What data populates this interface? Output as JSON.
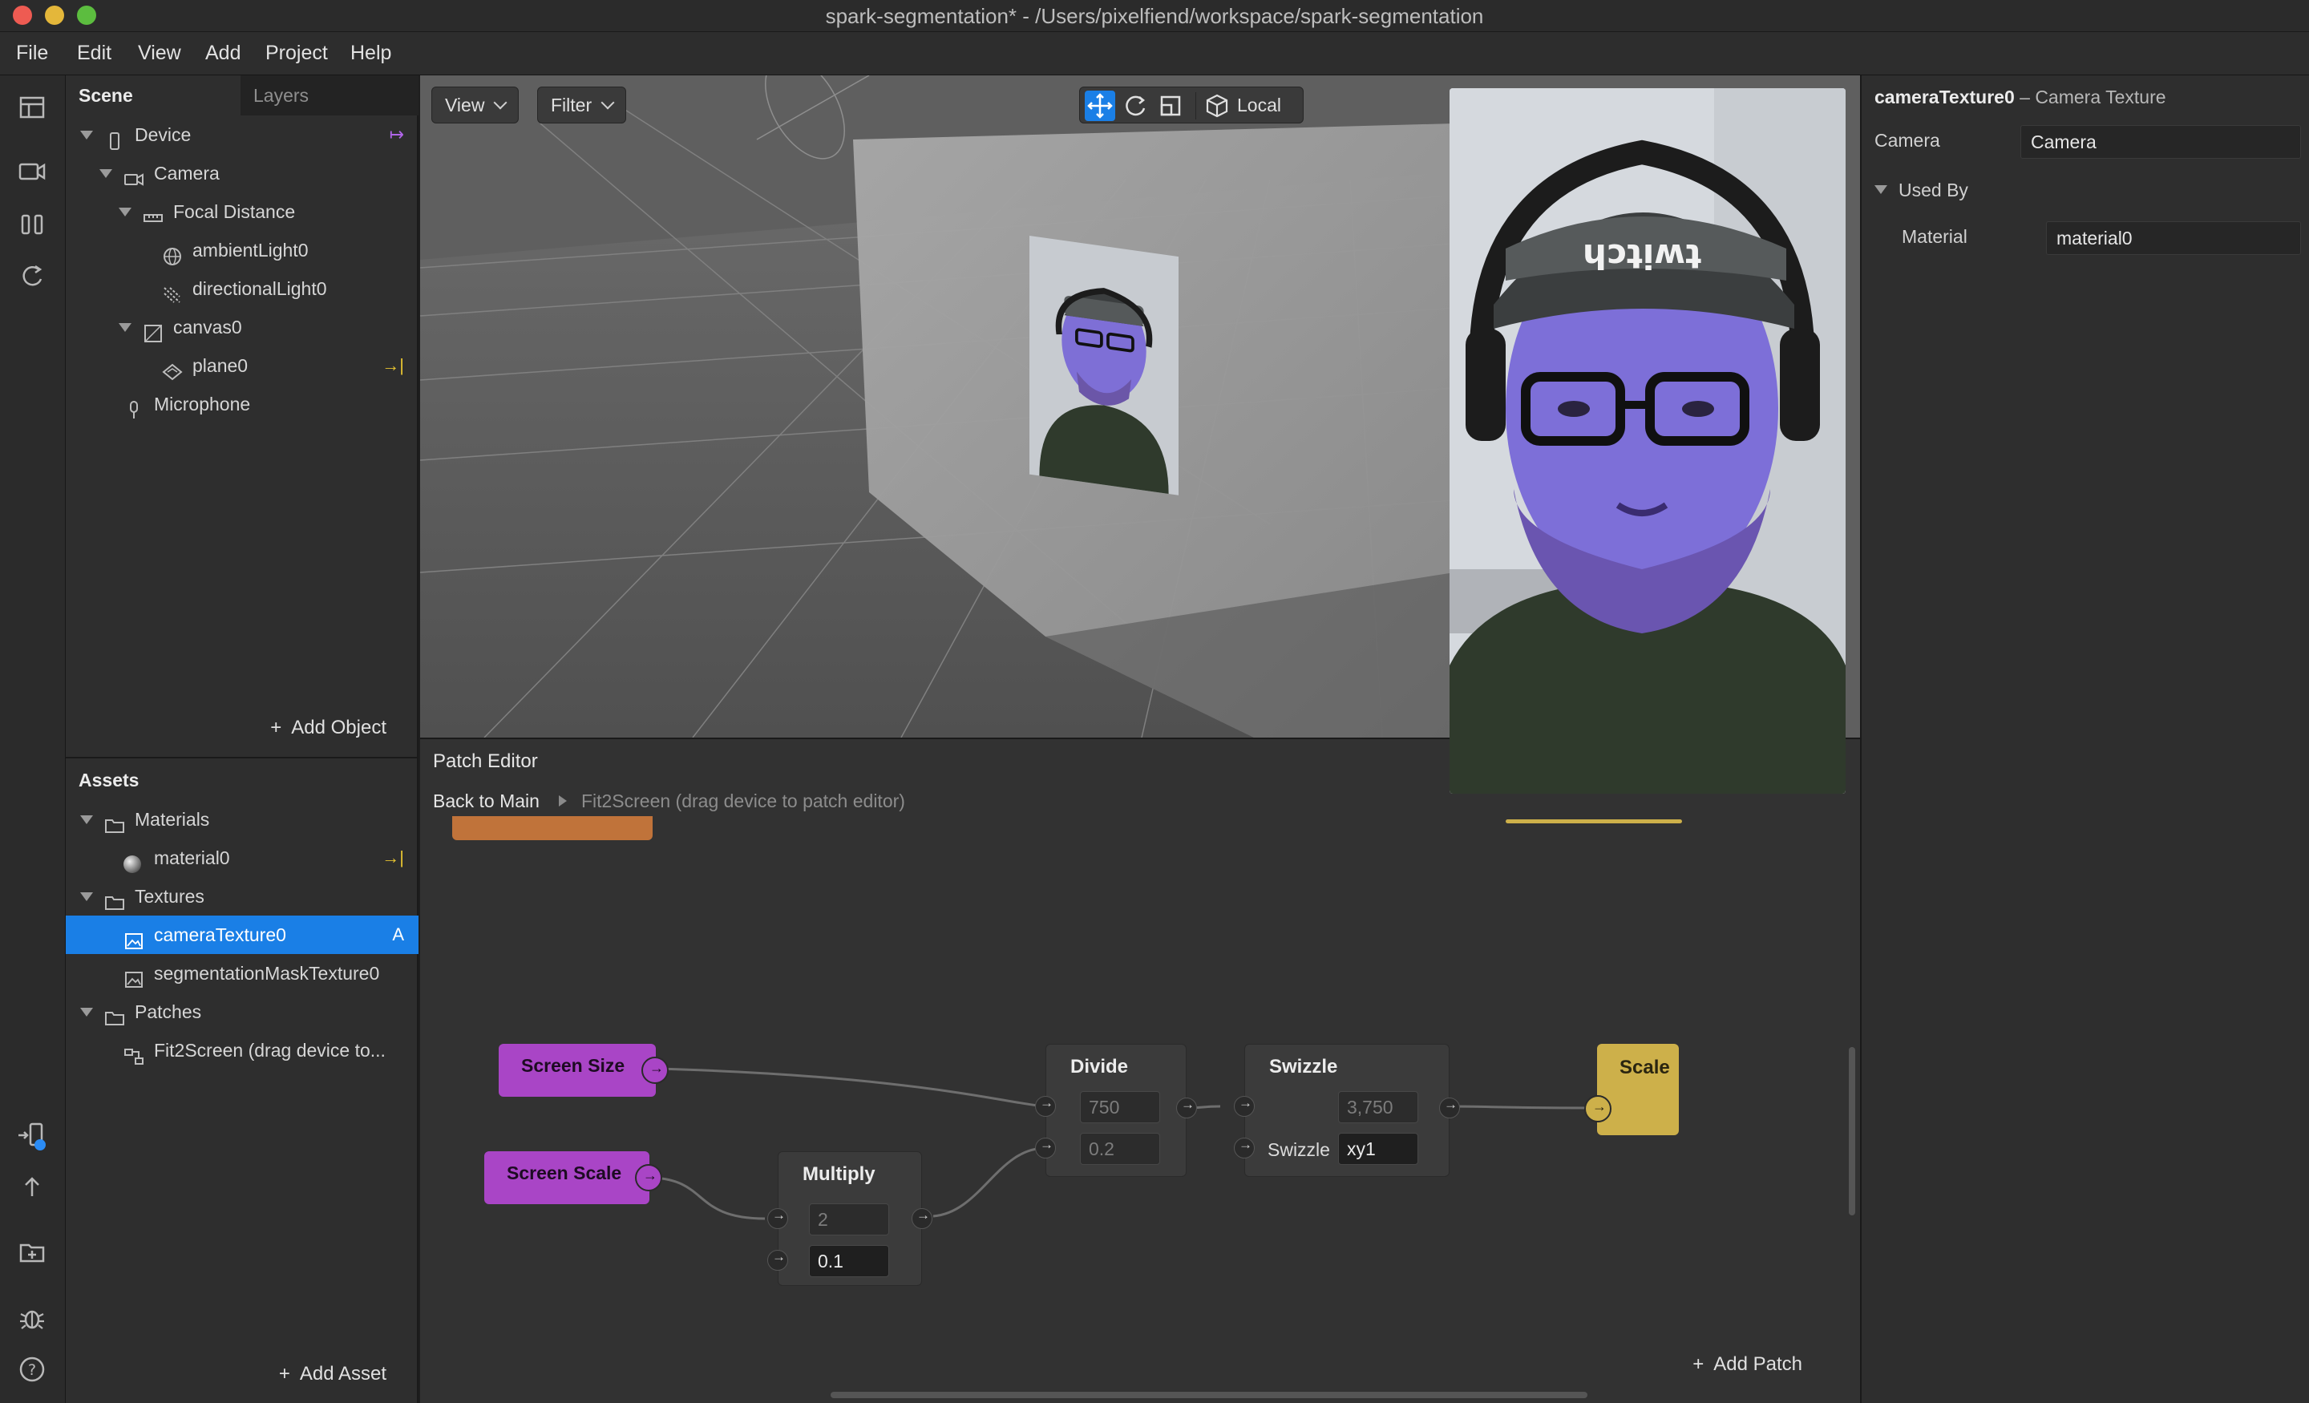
{
  "window": {
    "title": "spark-segmentation* - /Users/pixelfiend/workspace/spark-segmentation"
  },
  "menu": [
    "File",
    "Edit",
    "View",
    "Add",
    "Project",
    "Help"
  ],
  "scene": {
    "tabs": [
      "Scene",
      "Layers"
    ],
    "tree": [
      {
        "label": "Device",
        "icon": "device-icon"
      },
      {
        "label": "Camera",
        "icon": "camera-icon"
      },
      {
        "label": "Focal Distance",
        "icon": "focal-distance-icon"
      },
      {
        "label": "ambientLight0",
        "icon": "ambient-light-icon"
      },
      {
        "label": "directionalLight0",
        "icon": "directional-light-icon"
      },
      {
        "label": "canvas0",
        "icon": "canvas-icon"
      },
      {
        "label": "plane0",
        "icon": "plane-icon"
      },
      {
        "label": "Microphone",
        "icon": "microphone-icon"
      }
    ],
    "add_object": "Add Object"
  },
  "assets": {
    "title": "Assets",
    "tree": [
      {
        "label": "Materials",
        "icon": "folder-icon"
      },
      {
        "label": "material0",
        "icon": "material-sphere-icon"
      },
      {
        "label": "Textures",
        "icon": "folder-icon"
      },
      {
        "label": "cameraTexture0",
        "icon": "texture-icon",
        "badge": "A",
        "selected": true
      },
      {
        "label": "segmentationMaskTexture0",
        "icon": "texture-icon"
      },
      {
        "label": "Patches",
        "icon": "folder-icon"
      },
      {
        "label": "Fit2Screen (drag device to...",
        "icon": "patch-icon"
      }
    ],
    "add_asset": "Add Asset"
  },
  "viewport": {
    "view_label": "View",
    "filter_label": "Filter",
    "space_label": "Local"
  },
  "patch_editor": {
    "title": "Patch Editor",
    "back_label": "Back to Main",
    "breadcrumb_current": "Fit2Screen (drag device to patch editor)",
    "add_patch": "Add Patch",
    "nodes": {
      "screen_size": "Screen Size",
      "screen_scale": "Screen Scale",
      "multiply": {
        "title": "Multiply",
        "in1": "2",
        "in2": "0.1"
      },
      "divide": {
        "title": "Divide",
        "in1": "750",
        "in2": "0.2"
      },
      "swizzle": {
        "title": "Swizzle",
        "in1": "3,750",
        "param_label": "Swizzle",
        "param_value": "xy1"
      },
      "scale": "Scale"
    }
  },
  "inspector": {
    "object_name": "cameraTexture0",
    "object_type": "– Camera Texture",
    "camera_label": "Camera",
    "camera_value": "Camera",
    "used_by_label": "Used By",
    "material_label": "Material",
    "material_value": "material0"
  },
  "colors": {
    "accent": "#1a7fe6",
    "patch_purple": "#a945c6",
    "patch_yellow": "#cdb04a",
    "patch_orange": "#c0733a",
    "badge_yellow": "#e8c531",
    "badge_purple": "#b065e8"
  }
}
